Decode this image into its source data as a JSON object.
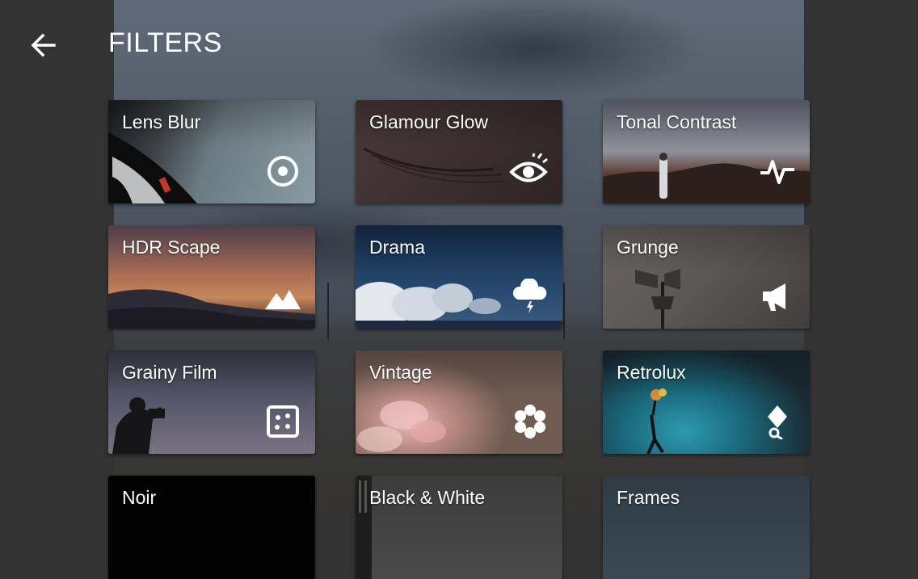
{
  "header": {
    "title": "FILTERS",
    "back_icon": "arrow-left-icon"
  },
  "filters": [
    {
      "label": "Lens Blur",
      "icon": "target-circle-icon"
    },
    {
      "label": "Glamour Glow",
      "icon": "eye-icon"
    },
    {
      "label": "Tonal Contrast",
      "icon": "pulse-wave-icon"
    },
    {
      "label": "HDR Scape",
      "icon": "mountains-icon"
    },
    {
      "label": "Drama",
      "icon": "storm-cloud-icon"
    },
    {
      "label": "Grunge",
      "icon": "megaphone-icon"
    },
    {
      "label": "Grainy Film",
      "icon": "film-grain-icon"
    },
    {
      "label": "Vintage",
      "icon": "flower-icon"
    },
    {
      "label": "Retrolux",
      "icon": "pin-magnifier-icon"
    },
    {
      "label": "Noir",
      "icon": ""
    },
    {
      "label": "Black & White",
      "icon": ""
    },
    {
      "label": "Frames",
      "icon": ""
    }
  ],
  "colors": {
    "app_background": "#333333",
    "text": "#ffffff"
  }
}
